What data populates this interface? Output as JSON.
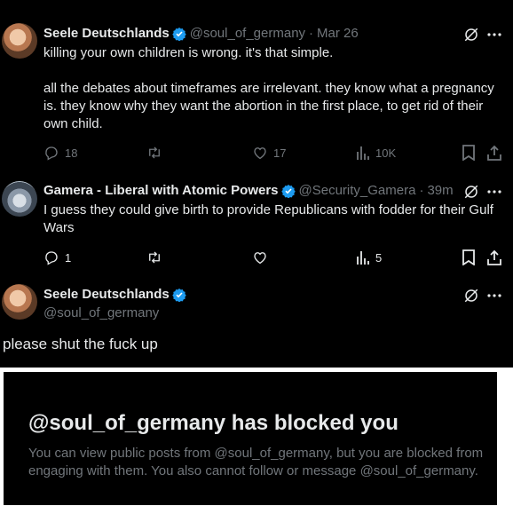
{
  "thread": [
    {
      "name": "Seele Deutschlands",
      "handle": "@soul_of_germany",
      "time": "Mar 26",
      "text": "killing your own children is wrong. it's that simple.\n\nall the debates about timeframes are irrelevant. they know what a pregnancy is. they know why they want the abortion in the first place, to get rid of their own child.",
      "replies": "18",
      "retweets": "",
      "likes": "17",
      "views": "10K"
    },
    {
      "name": "Gamera - Liberal with Atomic Powers",
      "handle": "@Security_Gamera",
      "time": "39m",
      "text": "I guess they could give birth to provide Republicans with fodder for their Gulf Wars",
      "replies": "1",
      "retweets": "",
      "likes": "",
      "views": "5"
    },
    {
      "name": "Seele Deutschlands",
      "handle": "@soul_of_germany",
      "text": "please shut the fuck up"
    }
  ],
  "separator": "·",
  "blocked": {
    "title": "@soul_of_germany has blocked you",
    "body": "You can view public posts from @soul_of_germany, but you are blocked from engaging with them. You also cannot follow or message @soul_of_germany."
  },
  "colors": {
    "background": "#000000",
    "text": "#e7e9ea",
    "muted": "#71767b",
    "verified": "#1d9bf0"
  },
  "icons": [
    "verified-badge-icon",
    "grok-icon",
    "more-icon",
    "reply-icon",
    "retweet-icon",
    "like-icon",
    "views-icon",
    "bookmark-icon",
    "share-icon"
  ]
}
